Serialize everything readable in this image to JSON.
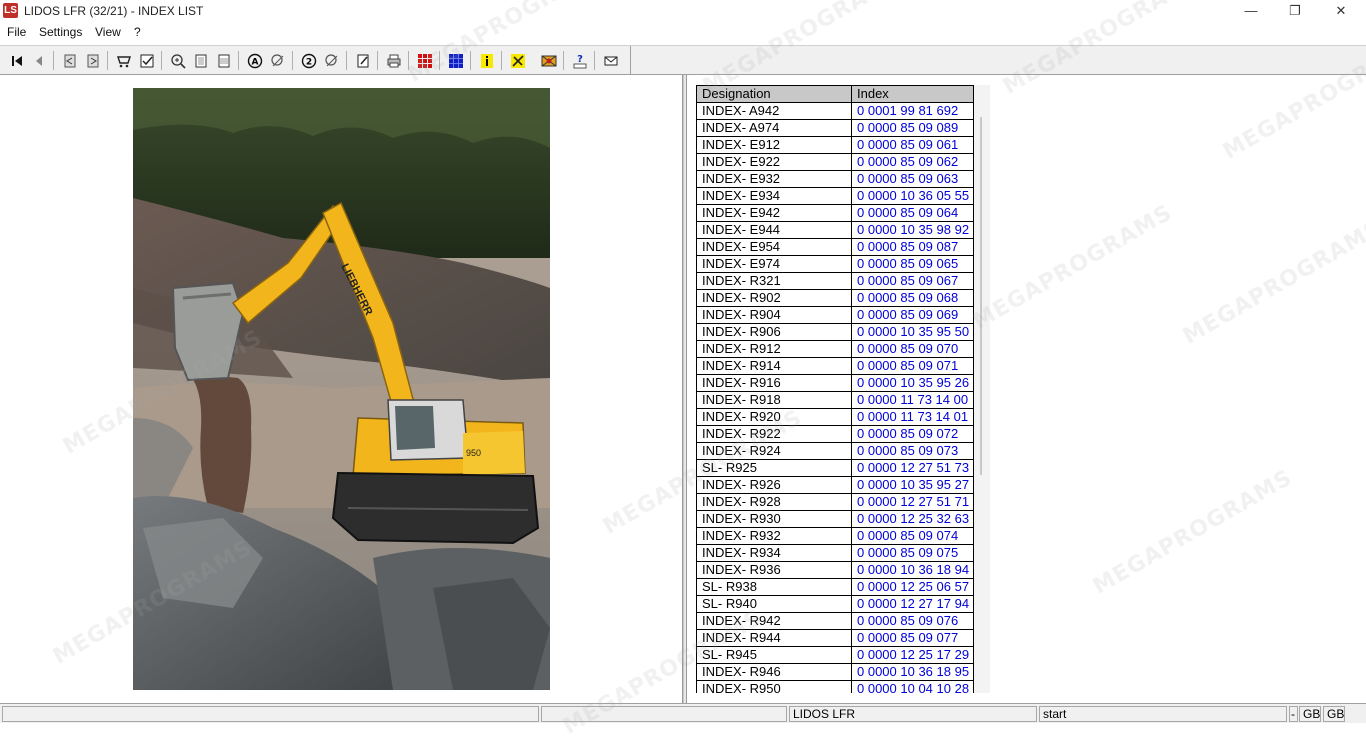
{
  "window": {
    "title": "LIDOS LFR (32/21) - INDEX LIST",
    "logo_text": "LS",
    "controls": {
      "minimize": "—",
      "maximize": "❐",
      "close": "✕"
    }
  },
  "menu": [
    "File",
    "Settings",
    "View",
    "?"
  ],
  "toolbar_icons": [
    "first-icon",
    "previous-icon",
    "back-page-icon",
    "forward-page-icon",
    "cart-icon",
    "checklist-icon",
    "zoom-in-icon",
    "fit-page-icon",
    "fit-width-icon",
    "search-a-icon",
    "search-a-clear-icon",
    "search-2-icon",
    "search-2-clear-icon",
    "notes-icon",
    "print-icon",
    "grid-red-icon",
    "grid-blue-icon",
    "info-icon",
    "tools-icon",
    "flag-icon",
    "help-icon",
    "mail-icon"
  ],
  "table": {
    "headers": {
      "designation": "Designation",
      "index": "Index"
    },
    "rows": [
      [
        "INDEX- A942",
        "0 0001 99 81 692"
      ],
      [
        "INDEX- A974",
        "0 0000 85 09 089"
      ],
      [
        "INDEX- E912",
        "0 0000 85 09 061"
      ],
      [
        "INDEX- E922",
        "0 0000 85 09 062"
      ],
      [
        "INDEX- E932",
        "0 0000 85 09 063"
      ],
      [
        "INDEX- E934",
        "0 0000 10 36 05 55"
      ],
      [
        "INDEX- E942",
        "0 0000 85 09 064"
      ],
      [
        "INDEX- E944",
        "0 0000 10 35 98 92"
      ],
      [
        "INDEX- E954",
        "0 0000 85 09 087"
      ],
      [
        "INDEX- E974",
        "0 0000 85 09 065"
      ],
      [
        "INDEX- R321",
        "0 0000 85 09 067"
      ],
      [
        "INDEX- R902",
        "0 0000 85 09 068"
      ],
      [
        "INDEX- R904",
        "0 0000 85 09 069"
      ],
      [
        "INDEX- R906",
        "0 0000 10 35 95 50"
      ],
      [
        "INDEX- R912",
        "0 0000 85 09 070"
      ],
      [
        "INDEX- R914",
        "0 0000 85 09 071"
      ],
      [
        "INDEX- R916",
        "0 0000 10 35 95 26"
      ],
      [
        "INDEX- R918",
        "0 0000 11 73 14 00"
      ],
      [
        "INDEX- R920",
        "0 0000 11 73 14 01"
      ],
      [
        "INDEX- R922",
        "0 0000 85 09 072"
      ],
      [
        "INDEX- R924",
        "0 0000 85 09 073"
      ],
      [
        "SL- R925",
        "0 0000 12 27 51 73"
      ],
      [
        "INDEX- R926",
        "0 0000 10 35 95 27"
      ],
      [
        "INDEX- R928",
        "0 0000 12 27 51 71"
      ],
      [
        "INDEX- R930",
        "0 0000 12 25 32 63"
      ],
      [
        "INDEX- R932",
        "0 0000 85 09 074"
      ],
      [
        "INDEX- R934",
        "0 0000 85 09 075"
      ],
      [
        "INDEX- R936",
        "0 0000 10 36 18 94"
      ],
      [
        "SL- R938",
        "0 0000 12 25 06 57"
      ],
      [
        "SL- R940",
        "0 0000 12 27 17 94"
      ],
      [
        "INDEX- R942",
        "0 0000 85 09 076"
      ],
      [
        "INDEX- R944",
        "0 0000 85 09 077"
      ],
      [
        "SL- R945",
        "0 0000 12 25 17 29"
      ],
      [
        "INDEX- R946",
        "0 0000 10 36 18 95"
      ],
      [
        "INDEX- R950",
        "0 0000 10 04 10 28"
      ]
    ]
  },
  "image": {
    "brand_text": "LIEBHERR",
    "model_text": "950"
  },
  "watermark": "MEGAPROGRAMS",
  "status": {
    "app": "LIDOS LFR",
    "state": "start",
    "dash": "-",
    "lang1": "GB",
    "lang2": "GB"
  }
}
